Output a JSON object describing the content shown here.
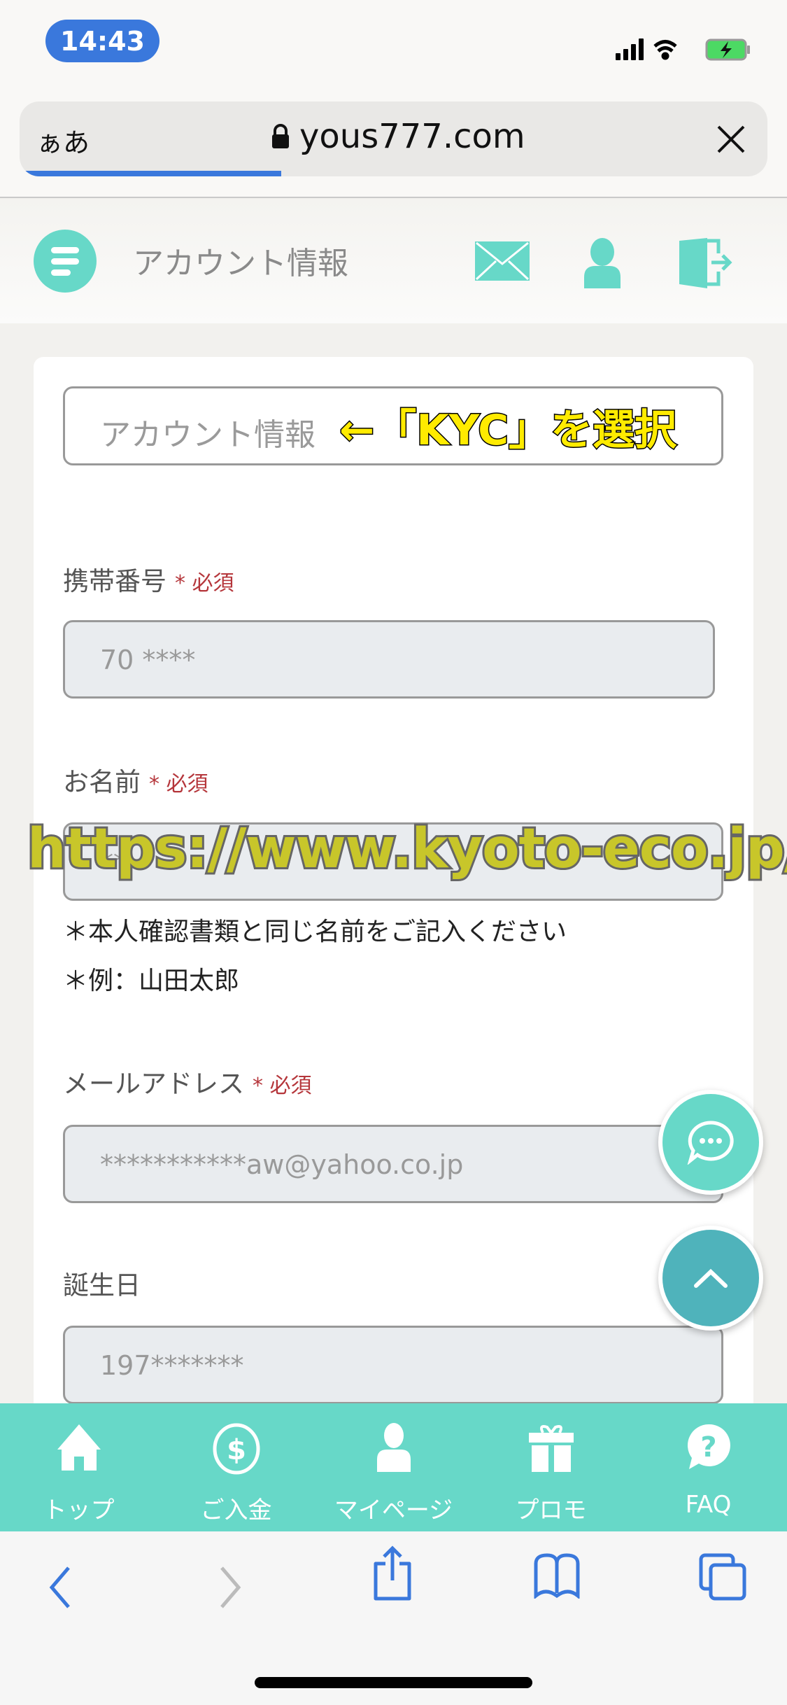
{
  "status_bar": {
    "time": "14:43"
  },
  "browser": {
    "aa_label": "ぁあ",
    "url": "yous777.com",
    "load_progress": 0.35,
    "accent": "#3a78dc"
  },
  "header": {
    "title": "アカウント情報",
    "icons": [
      "menu-icon",
      "mail-icon",
      "user-icon",
      "logout-icon"
    ],
    "brand_color": "#67d8c8"
  },
  "form": {
    "section_select": {
      "value": "アカウント情報"
    },
    "annotation": "←「KYC」を選択",
    "required_label": "* 必須",
    "fields": [
      {
        "label": "携帯番号",
        "required": true,
        "value": "70 ****"
      },
      {
        "label": "お名前",
        "required": true,
        "value": "**"
      },
      {
        "label": "メールアドレス",
        "required": true,
        "value": "***********aw@yahoo.co.jp"
      },
      {
        "label": "誕生日",
        "required": false,
        "value": "197*******"
      }
    ],
    "name_notes": [
      "＊本人確認書類と同じ名前をご記入ください",
      "＊例：山田太郎"
    ]
  },
  "watermark": "https://www.kyoto-eco.jp/",
  "bottom_nav": [
    {
      "label": "トップ",
      "icon": "home-icon"
    },
    {
      "label": "ご入金",
      "icon": "dollar-icon"
    },
    {
      "label": "マイページ",
      "icon": "user-icon"
    },
    {
      "label": "プロモ",
      "icon": "gift-icon"
    },
    {
      "label": "FAQ",
      "icon": "question-icon"
    }
  ],
  "safari_toolbar": [
    "back-icon",
    "forward-icon",
    "share-icon",
    "bookmarks-icon",
    "tabs-icon"
  ]
}
